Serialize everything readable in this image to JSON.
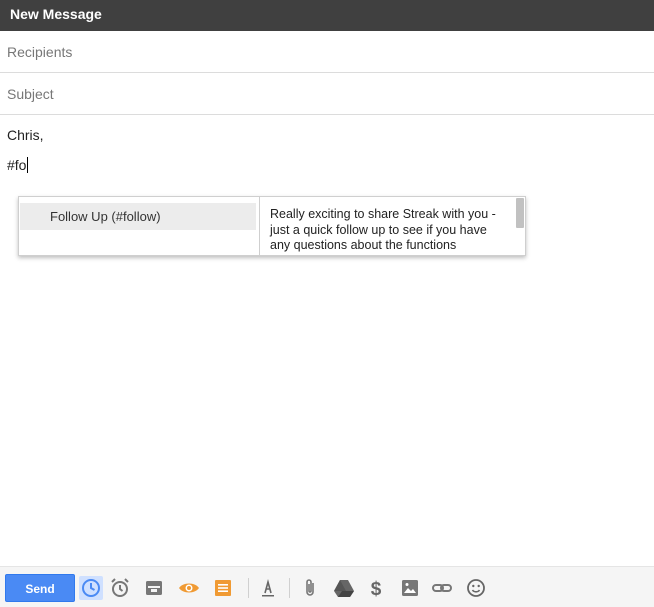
{
  "window": {
    "title": "New Message"
  },
  "compose": {
    "recipients_placeholder": "Recipients",
    "subject_placeholder": "Subject",
    "body_line1": "Chris,",
    "body_line2": "#fo"
  },
  "snippets": {
    "items": [
      {
        "label": "Follow Up (#follow)"
      }
    ],
    "preview": "Really exciting to share Streak with you - just a quick follow up to see if you have any questions about the functions"
  },
  "toolbar": {
    "send_label": "Send",
    "icons": [
      "send-later-icon",
      "reminder-icon",
      "templates-icon",
      "tracking-icon",
      "snippets-icon",
      "formatting-icon",
      "attach-icon",
      "drive-icon",
      "money-icon",
      "photo-icon",
      "link-icon",
      "emoji-icon"
    ],
    "colors": {
      "send": "#4a8af4",
      "orange": "#f09a33",
      "gray": "#777777"
    }
  }
}
